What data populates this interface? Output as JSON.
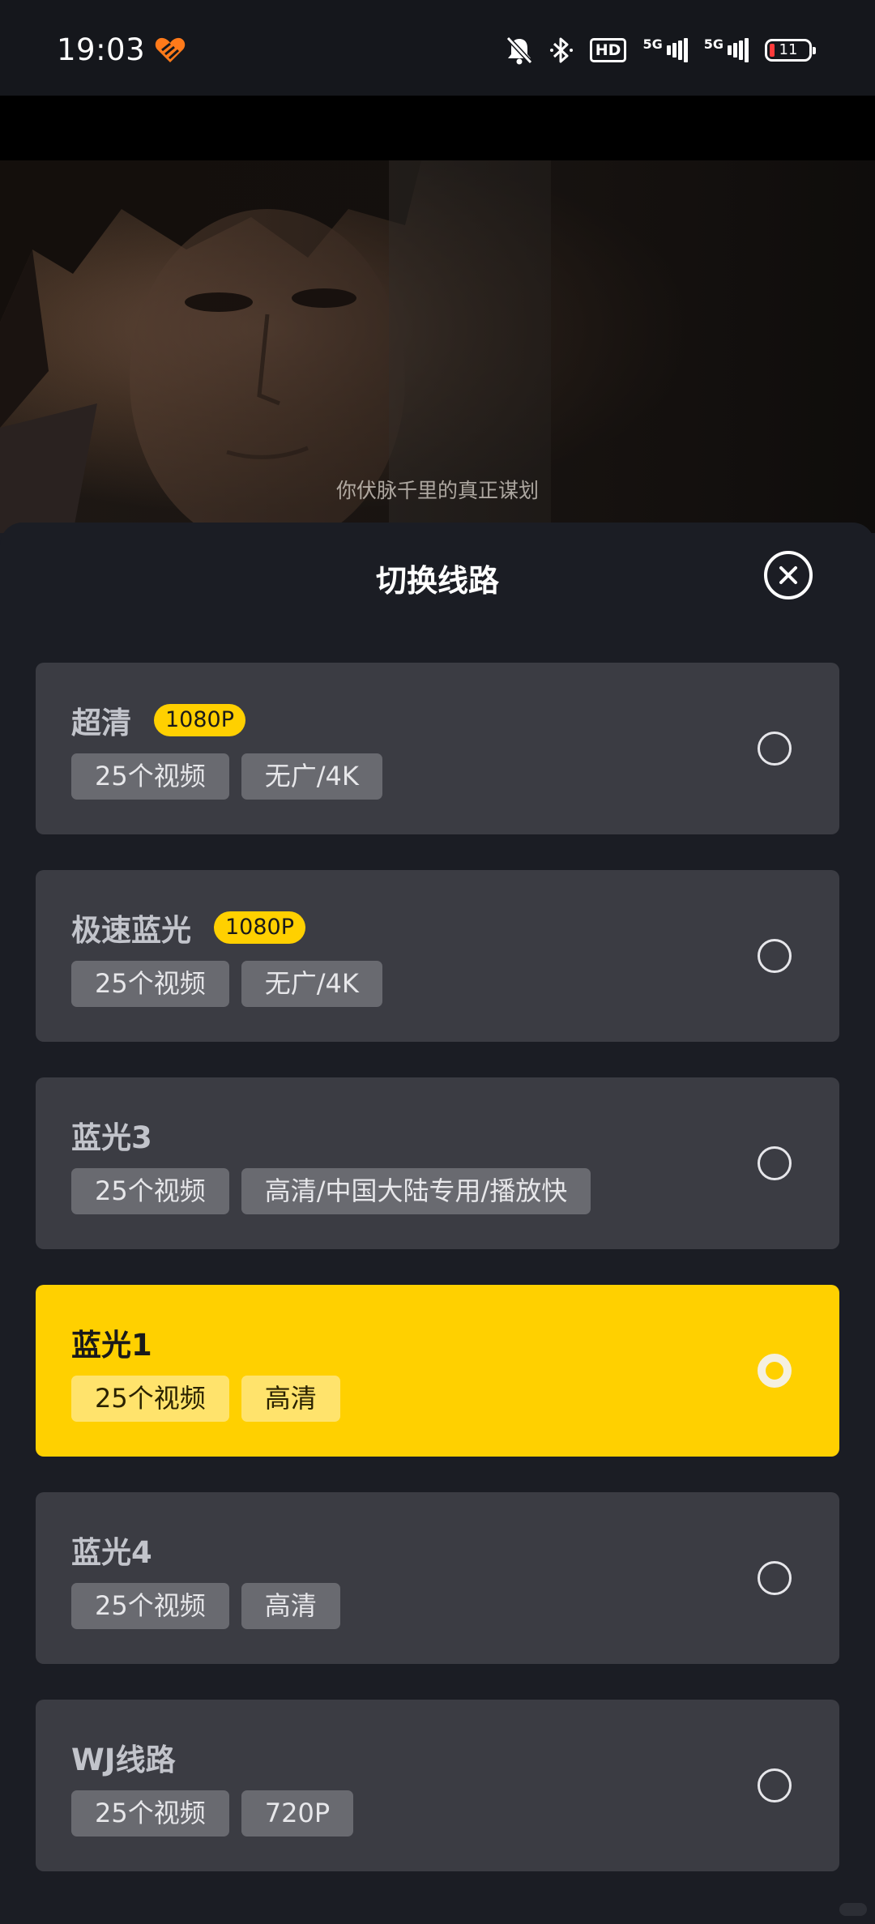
{
  "status_bar": {
    "time": "19:03",
    "hd_label": "HD",
    "network_1": "5G",
    "network_2": "5G",
    "battery_level": "11",
    "icons": [
      "app-heart-icon",
      "bell-muted-icon",
      "bluetooth-icon",
      "hd-voice-icon",
      "signal-5g-icon",
      "signal-5g-icon",
      "battery-icon"
    ]
  },
  "video": {
    "subtitle": "你伏脉千里的真正谋划"
  },
  "sheet": {
    "title": "切换线路",
    "close_icon": "close-circle-icon",
    "routes": [
      {
        "name": "超清",
        "badge": "1080P",
        "tags": [
          "25个视频",
          "无广/4K"
        ],
        "selected": false
      },
      {
        "name": "极速蓝光",
        "badge": "1080P",
        "tags": [
          "25个视频",
          "无广/4K"
        ],
        "selected": false
      },
      {
        "name": "蓝光3",
        "badge": "",
        "tags": [
          "25个视频",
          "高清/中国大陆专用/播放快"
        ],
        "selected": false
      },
      {
        "name": "蓝光1",
        "badge": "",
        "tags": [
          "25个视频",
          "高清"
        ],
        "selected": true
      },
      {
        "name": "蓝光4",
        "badge": "",
        "tags": [
          "25个视频",
          "高清"
        ],
        "selected": false
      },
      {
        "name": "WJ线路",
        "badge": "",
        "tags": [
          "25个视频",
          "720P"
        ],
        "selected": false
      }
    ]
  },
  "colors": {
    "accent": "#ffd000",
    "card_bg": "#3b3c43",
    "sheet_bg": "#1b1d24",
    "tag_bg": "#696a70"
  }
}
